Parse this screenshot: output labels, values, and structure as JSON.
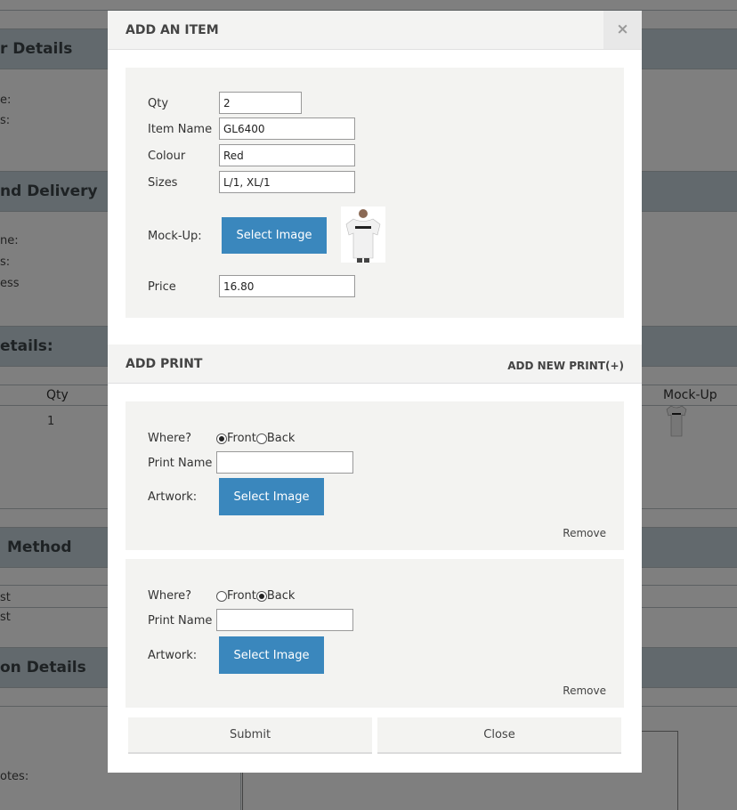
{
  "background": {
    "sections": [
      {
        "title": "r Details"
      },
      {
        "title": "nd Delivery"
      },
      {
        "title": "etails:"
      },
      {
        "title": "Method"
      },
      {
        "title": "on Details"
      }
    ],
    "labels": [
      "e:",
      "s:",
      "ne:",
      "s:",
      "ess",
      "st",
      "st",
      "otes:"
    ],
    "table": {
      "qty_header": "Qty",
      "mockup_header": "Mock-Up",
      "qty_value": "1"
    }
  },
  "modal": {
    "title": "ADD AN ITEM",
    "close_icon": "×",
    "item": {
      "qty_label": "Qty",
      "qty_value": "2",
      "name_label": "Item Name",
      "name_value": "GL6400",
      "colour_label": "Colour",
      "colour_value": "Red",
      "sizes_label": "Sizes",
      "sizes_value": "L/1, XL/1",
      "mockup_label": "Mock-Up:",
      "select_image": "Select Image",
      "price_label": "Price",
      "price_value": "16.80"
    },
    "print_section": {
      "title": "ADD PRINT",
      "add_new": "ADD NEW PRINT(+)"
    },
    "prints": [
      {
        "where_label": "Where?",
        "front": "Front",
        "back": "Back",
        "selected": "front",
        "print_name_label": "Print Name",
        "print_name_value": "",
        "artwork_label": "Artwork:",
        "select_image": "Select Image",
        "remove": "Remove"
      },
      {
        "where_label": "Where?",
        "front": "Front",
        "back": "Back",
        "selected": "back",
        "print_name_label": "Print Name",
        "print_name_value": "",
        "artwork_label": "Artwork:",
        "select_image": "Select Image",
        "remove": "Remove"
      }
    ],
    "footer": {
      "submit": "Submit",
      "close": "Close"
    }
  }
}
